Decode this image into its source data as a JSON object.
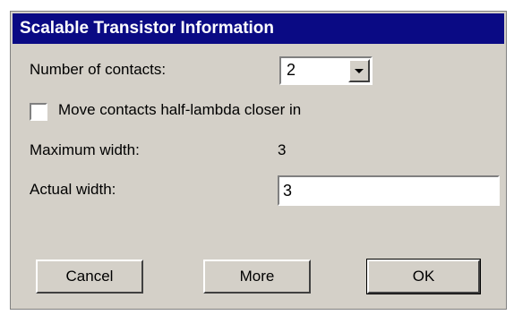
{
  "dialog": {
    "title": "Scalable Transistor Information",
    "contacts_label": "Number of contacts:",
    "contacts_value": "2",
    "move_contacts_label": "Move contacts half-lambda closer in",
    "move_contacts_checked": false,
    "max_width_label": "Maximum width:",
    "max_width_value": "3",
    "actual_width_label": "Actual width:",
    "actual_width_value": "3",
    "buttons": {
      "cancel": "Cancel",
      "more": "More",
      "ok": "OK"
    }
  },
  "colors": {
    "titlebar_bg": "#0a0a84",
    "dialog_bg": "#d4d0c8"
  }
}
